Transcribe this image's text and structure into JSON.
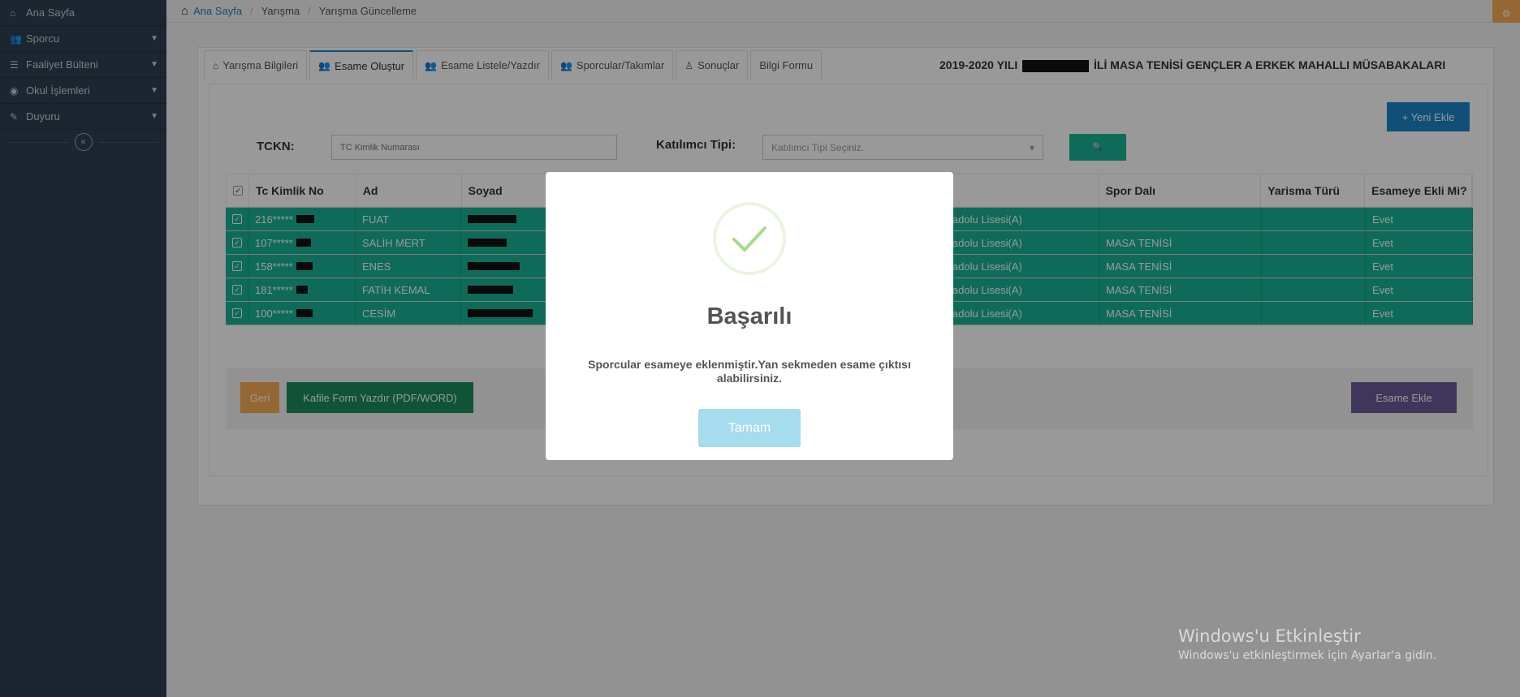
{
  "sidebar": {
    "items": [
      {
        "icon": "home-icon",
        "label": "Ana Sayfa",
        "has_chevron": false
      },
      {
        "icon": "users-icon",
        "label": "Sporcu",
        "has_chevron": true
      },
      {
        "icon": "list-icon",
        "label": "Faaliyet Bülteni",
        "has_chevron": true
      },
      {
        "icon": "school-icon",
        "label": "Okul İşlemleri",
        "has_chevron": true
      },
      {
        "icon": "edit-icon",
        "label": "Duyuru",
        "has_chevron": true
      }
    ],
    "collapse_icon": "«"
  },
  "breadcrumb": {
    "home": "Ana Sayfa",
    "sep": "/",
    "level1": "Yarışma",
    "level2": "Yarışma Güncelleme"
  },
  "tabs": [
    {
      "icon": "home-icon",
      "label": "Yarışma Bilgileri",
      "active": false
    },
    {
      "icon": "users-icon",
      "label": "Esame Oluştur",
      "active": true
    },
    {
      "icon": "users-icon",
      "label": "Esame Listele/Yazdır",
      "active": false
    },
    {
      "icon": "team-icon",
      "label": "Sporcular/Takımlar",
      "active": false
    },
    {
      "icon": "trophy-icon",
      "label": "Sonuçlar",
      "active": false
    },
    {
      "icon": "",
      "label": "Bilgi Formu",
      "active": false
    }
  ],
  "headline": {
    "prefix": "2019-2020 YILI",
    "suffix": "İLİ MASA TENİSİ GENÇLER A ERKEK MAHALLI MÜSABAKALARI"
  },
  "form": {
    "new_button": "+ Yeni Ekle",
    "tckn_label": "TCKN:",
    "tckn_placeholder": "TC Kimlik Numarası",
    "type_label": "Katılımcı Tipi:",
    "type_placeholder": "Katılımcı Tipi Seçiniz.",
    "search_icon": "🔍"
  },
  "table": {
    "headers": [
      "Tc Kimlik No",
      "Ad",
      "Soyad",
      "",
      "Spor Dalı",
      "Yarisma Türü",
      "Esameye Ekli Mi?"
    ],
    "rows": [
      {
        "tc": "216*****",
        "ad": "FUAT",
        "okul": "Anadolu Lisesi(A)",
        "spor": "",
        "tur": "",
        "ekli": "Evet"
      },
      {
        "tc": "107*****",
        "ad": "SALİH MERT",
        "okul": "Anadolu Lisesi(A)",
        "spor": "MASA TENİSİ",
        "tur": "",
        "ekli": "Evet"
      },
      {
        "tc": "158*****",
        "ad": "ENES",
        "okul": "Anadolu Lisesi(A)",
        "spor": "MASA TENİSİ",
        "tur": "",
        "ekli": "Evet"
      },
      {
        "tc": "181*****",
        "ad": "FATİH KEMAL",
        "okul": "Anadolu Lisesi(A)",
        "spor": "MASA TENİSİ",
        "tur": "",
        "ekli": "Evet"
      },
      {
        "tc": "100*****",
        "ad": "CESİM",
        "okul": "Anadolu Lisesi(A)",
        "spor": "MASA TENİSİ",
        "tur": "",
        "ekli": "Evet"
      }
    ]
  },
  "footer": {
    "back": "Geri",
    "kafile": "Kafile Form Yazdır (PDF/WORD)",
    "esame_ekle": "Esame Ekle"
  },
  "modal": {
    "title": "Başarılı",
    "text": "Sporcular esameye eklenmiştir.Yan sekmeden esame çıktısı alabilirsiniz.",
    "button": "Tamam"
  },
  "watermark": {
    "line1": "Windows'u Etkinleştir",
    "line2": "Windows'u etkinleştirmek için Ayarlar'a gidin."
  },
  "colors": {
    "sidebar": "#2f4050",
    "primary": "#1c84c6",
    "success": "#1ab394",
    "check": "#a5dc86",
    "modal_button": "#a5dcee"
  }
}
